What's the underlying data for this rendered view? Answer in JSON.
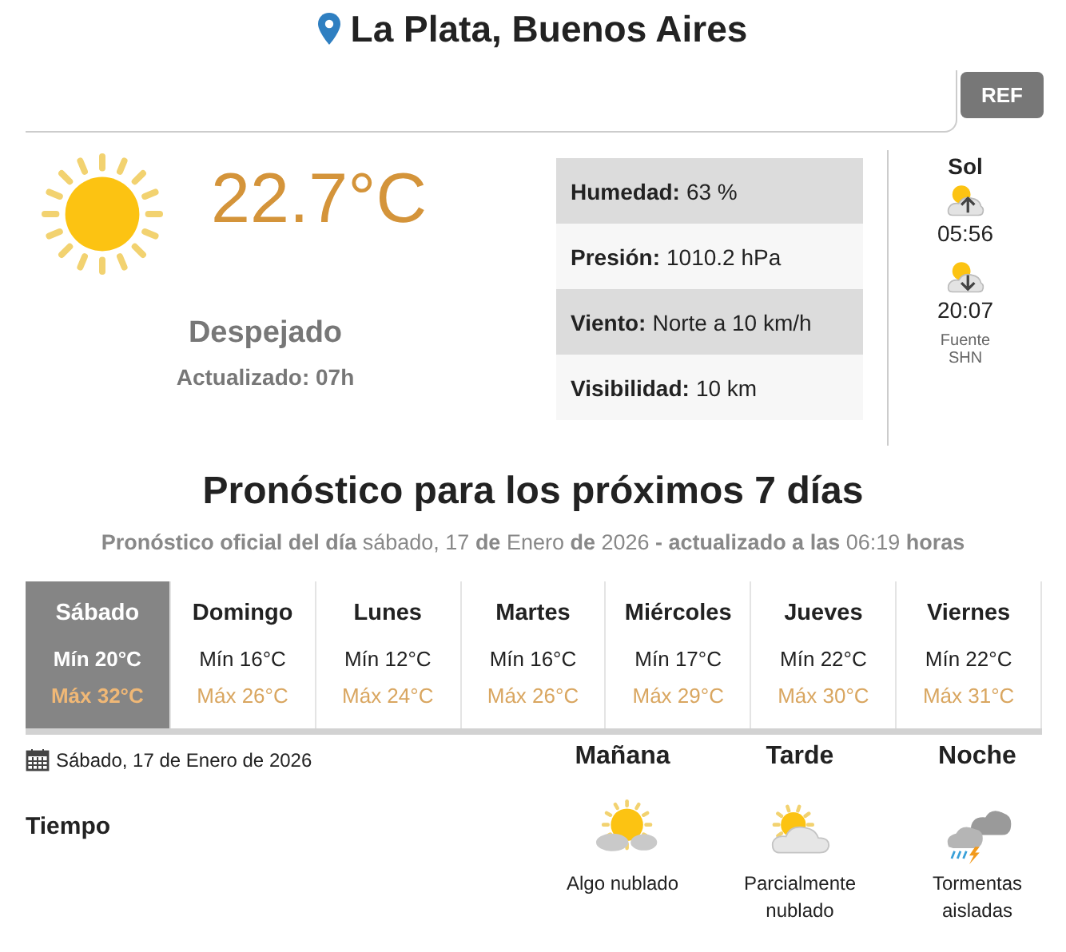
{
  "location": {
    "title": "La Plata, Buenos Aires"
  },
  "ref_button": {
    "label": "REF"
  },
  "current": {
    "temperature": "22.7°C",
    "condition": "Despejado",
    "updated": "Actualizado: 07h",
    "details": [
      {
        "label": "Humedad:",
        "value": "63 %"
      },
      {
        "label": "Presión:",
        "value": "1010.2 hPa"
      },
      {
        "label": "Viento:",
        "value": "Norte a 10 km/h"
      },
      {
        "label": "Visibilidad:",
        "value": "10 km"
      }
    ],
    "sun": {
      "title": "Sol",
      "sunrise": "05:56",
      "sunset": "20:07",
      "source": "Fuente",
      "source_name": "SHN"
    }
  },
  "forecast": {
    "title": "Pronóstico para los próximos 7 días",
    "subtitle": "**Pronóstico oficial del día** sábado, 17 **de** Enero **de** 2026 **- actualizado a las** 06:19 **horas**",
    "days": [
      {
        "name": "Sábado",
        "min": "Mín 20°C",
        "max": "Máx 32°C",
        "selected": true
      },
      {
        "name": "Domingo",
        "min": "Mín 16°C",
        "max": "Máx 26°C",
        "selected": false
      },
      {
        "name": "Lunes",
        "min": "Mín 12°C",
        "max": "Máx 24°C",
        "selected": false
      },
      {
        "name": "Martes",
        "min": "Mín 16°C",
        "max": "Máx 26°C",
        "selected": false
      },
      {
        "name": "Miércoles",
        "min": "Mín 17°C",
        "max": "Máx 29°C",
        "selected": false
      },
      {
        "name": "Jueves",
        "min": "Mín 22°C",
        "max": "Máx 30°C",
        "selected": false
      },
      {
        "name": "Viernes",
        "min": "Mín 22°C",
        "max": "Máx 31°C",
        "selected": false
      }
    ]
  },
  "detail": {
    "date": "Sábado, 17 de Enero de 2026",
    "row_label": "Tiempo",
    "periods": [
      {
        "name": "Mañana",
        "kind": "sun_cloud",
        "condition": "Algo nublado"
      },
      {
        "name": "Tarde",
        "kind": "cloud_sun",
        "condition": "Parcialmente nublado"
      },
      {
        "name": "Noche",
        "kind": "storm",
        "condition": "Tormentas aisladas"
      }
    ]
  }
}
